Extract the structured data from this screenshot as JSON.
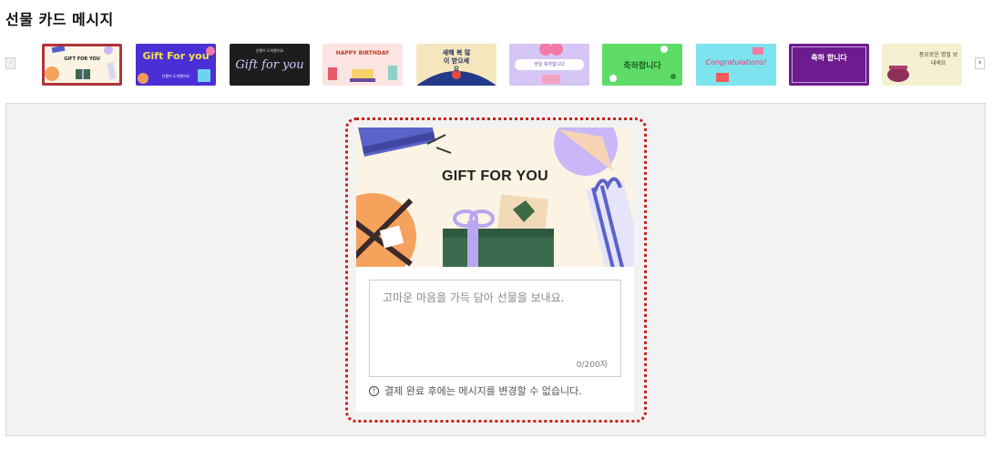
{
  "header": {
    "title": "선물 카드 메시지"
  },
  "carousel": {
    "prev_icon": "chevron-left-icon",
    "next_icon": "chevron-right-icon",
    "prev_glyph": "‹",
    "next_glyph": "›",
    "selected_index": 0,
    "thumbnails": [
      {
        "id": "gift-for-you-cream",
        "text": "GIFT FOR YOU",
        "bg": "#fbf4e4",
        "fg": "#222"
      },
      {
        "id": "gift-for-you-purple",
        "text": "Gift For you",
        "sub": "선물이 도착했어요",
        "bg": "#4a2fd6",
        "fg": "#f6e24b"
      },
      {
        "id": "gift-for-you-dark",
        "text": "Gift for you",
        "sub": "선물이 도착했어요",
        "bg": "#1d1d1d",
        "fg": "#d6c8ff"
      },
      {
        "id": "happy-birthday",
        "text": "HAPPY BIRTHDAY",
        "bg": "#fbe4e2",
        "fg": "#c0392b"
      },
      {
        "id": "new-year",
        "text": "새해 복 많이 받으세요",
        "bg": "#f5e7bd",
        "fg": "#1e2a5a"
      },
      {
        "id": "birthday-lilac",
        "text": "생일 축하합니다",
        "bg": "#d5c6f5",
        "fg": "#6a4cc9"
      },
      {
        "id": "congrats-green",
        "text": "축하합니다",
        "bg": "#5fdb67",
        "fg": "#1a5e23"
      },
      {
        "id": "congratulations-cyan",
        "text": "Congratulations!",
        "bg": "#7de3ef",
        "fg": "#e63a6e"
      },
      {
        "id": "congrats-purple",
        "text": "축하 합니다",
        "bg": "#6d1c8f",
        "fg": "#ffffff"
      },
      {
        "id": "happy-holidays",
        "text": "풍요로운 명절 보내세요",
        "bg": "#f4f0d0",
        "fg": "#5a3a3a"
      }
    ]
  },
  "card": {
    "image_title": "GIFT FOR YOU",
    "message_placeholder": "고마운 마음을 가득 담아 선물을 보내요.",
    "counter": "0/200자",
    "notice_icon": "info-icon",
    "notice_glyph": "!",
    "notice": "결제 완료 후에는 메시지를 변경할 수 없습니다."
  },
  "colors": {
    "selected_border": "#b0343a",
    "focus_dotted_border": "#cc1f1f",
    "panel_bg": "#f2f2f2"
  }
}
